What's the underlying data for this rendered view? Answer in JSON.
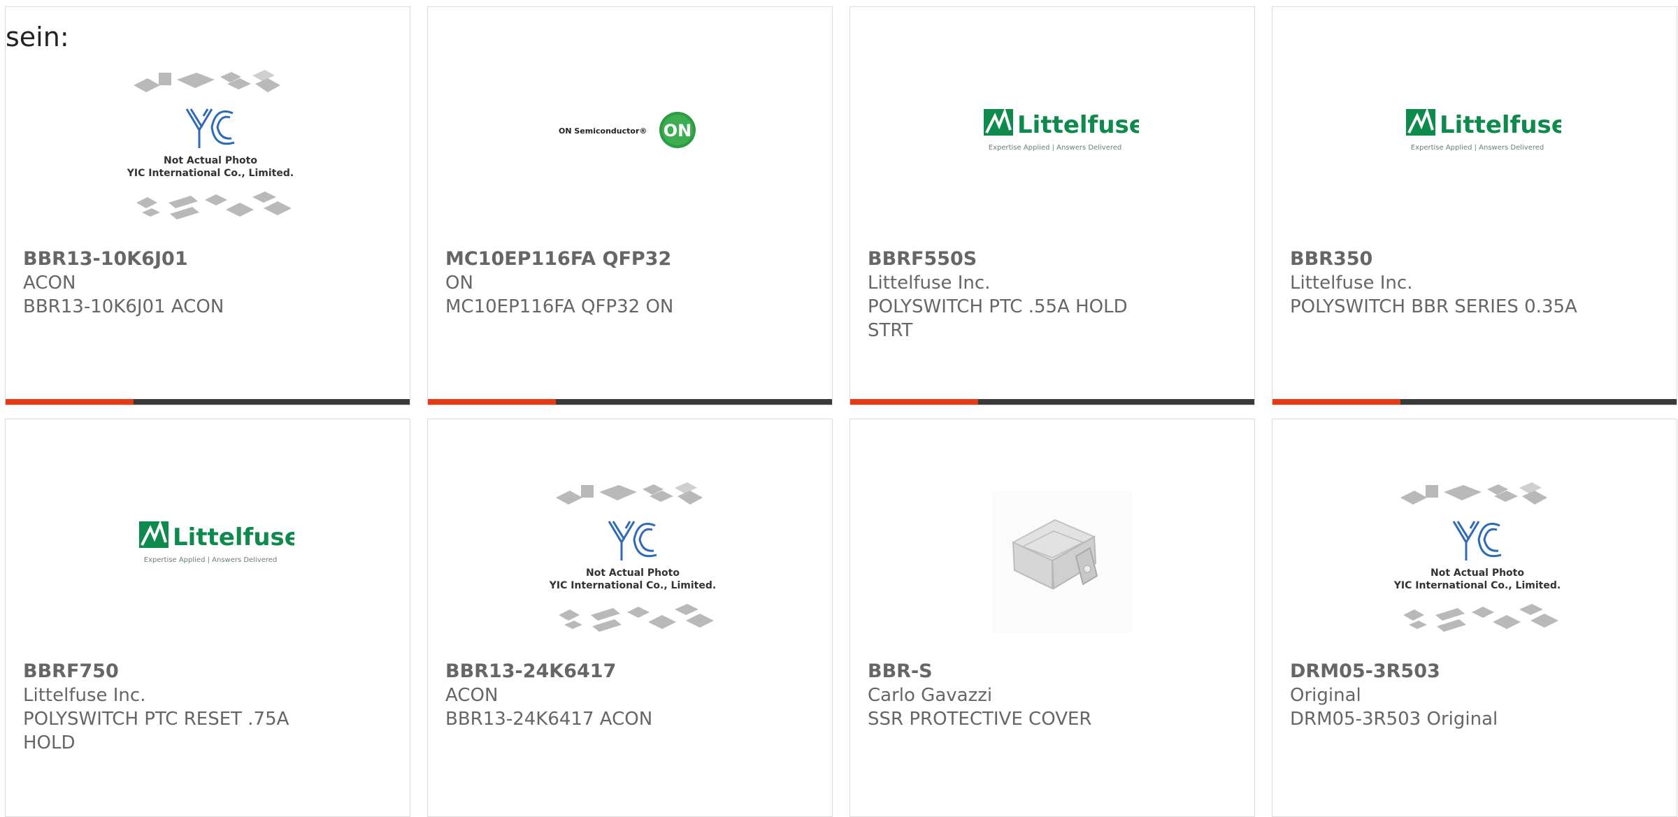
{
  "intro_text": "sein:",
  "colors": {
    "accent": "#e63a14",
    "bar": "#3a3a3a",
    "text": "#666666",
    "border": "#dcdcdc",
    "littelfuse_green": "#0e8a4c"
  },
  "products": [
    {
      "part": "BBR13-10K6J01",
      "maker": "ACON",
      "desc": "BBR13-10K6J01 ACON",
      "image": "yic-placeholder",
      "image_text": {
        "line1": "Not Actual Photo",
        "line2": "YIC International Co., Limited."
      }
    },
    {
      "part": "MC10EP116FA QFP32",
      "maker": "ON",
      "desc": "MC10EP116FA QFP32 ON",
      "image": "on-semi-logo",
      "image_text": {
        "brand": "ON Semiconductor®",
        "badge": "ON"
      }
    },
    {
      "part": "BBRF550S",
      "maker": "Littelfuse Inc.",
      "desc": "POLYSWITCH PTC .55A HOLD STRT",
      "image": "littelfuse-logo",
      "image_text": {
        "brand": "Littelfuse",
        "tagline": "Expertise Applied | Answers Delivered"
      }
    },
    {
      "part": "BBR350",
      "maker": "Littelfuse Inc.",
      "desc": "POLYSWITCH BBR SERIES 0.35A",
      "image": "littelfuse-logo",
      "image_text": {
        "brand": "Littelfuse",
        "tagline": "Expertise Applied | Answers Delivered"
      }
    },
    {
      "part": "BBRF750",
      "maker": "Littelfuse Inc.",
      "desc": "POLYSWITCH PTC RESET .75A HOLD",
      "image": "littelfuse-logo",
      "image_text": {
        "brand": "Littelfuse",
        "tagline": "Expertise Applied | Answers Delivered"
      }
    },
    {
      "part": "BBR13-24K6417",
      "maker": "ACON",
      "desc": "BBR13-24K6417 ACON",
      "image": "yic-placeholder",
      "image_text": {
        "line1": "Not Actual Photo",
        "line2": "YIC International Co., Limited."
      }
    },
    {
      "part": "BBR-S",
      "maker": "Carlo Gavazzi",
      "desc": "SSR PROTECTIVE COVER",
      "image": "protective-cover-photo",
      "image_text": {}
    },
    {
      "part": "DRM05-3R503",
      "maker": "Original",
      "desc": "DRM05-3R503 Original",
      "image": "yic-placeholder",
      "image_text": {
        "line1": "Not Actual Photo",
        "line2": "YIC International Co., Limited."
      }
    }
  ]
}
